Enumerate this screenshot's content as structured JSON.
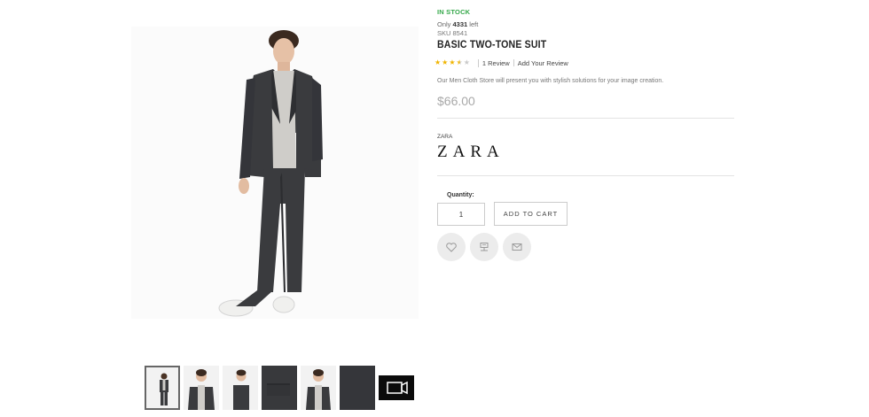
{
  "product": {
    "stock_status": "IN STOCK",
    "availability_prefix": "Only ",
    "availability_count": "4331",
    "availability_suffix": " left",
    "sku_label": "SKU",
    "sku_value": "8541",
    "title": "BASIC TWO-TONE SUIT",
    "rating_value": 3.5,
    "rating_max": 5,
    "review_count_text": "1  Review",
    "add_review_text": "Add Your Review",
    "description": "Our Men Cloth Store will present you with stylish solutions for your image creation.",
    "price": "$66.00",
    "brand_label": "ZARA",
    "brand_logo": "ZARA",
    "quantity_label": "Quantity:",
    "quantity_value": "1",
    "add_to_cart_label": "ADD TO CART"
  },
  "actions": [
    {
      "icon": "heart-icon"
    },
    {
      "icon": "compare-icon"
    },
    {
      "icon": "mail-icon"
    }
  ],
  "thumbnails": [
    {
      "kind": "full-suit",
      "active": true
    },
    {
      "kind": "upper-front",
      "active": false
    },
    {
      "kind": "upper-side",
      "active": false
    },
    {
      "kind": "fabric-pocket",
      "active": false
    },
    {
      "kind": "upper-front-2",
      "active": false
    },
    {
      "kind": "fabric",
      "active": false
    },
    {
      "kind": "video",
      "active": false
    }
  ],
  "colors": {
    "stock_green": "#35a84a",
    "star_on": "#f0b400",
    "star_off": "#c9c9c9",
    "suit": "#3a3b3e",
    "tshirt": "#cfcdc9"
  }
}
